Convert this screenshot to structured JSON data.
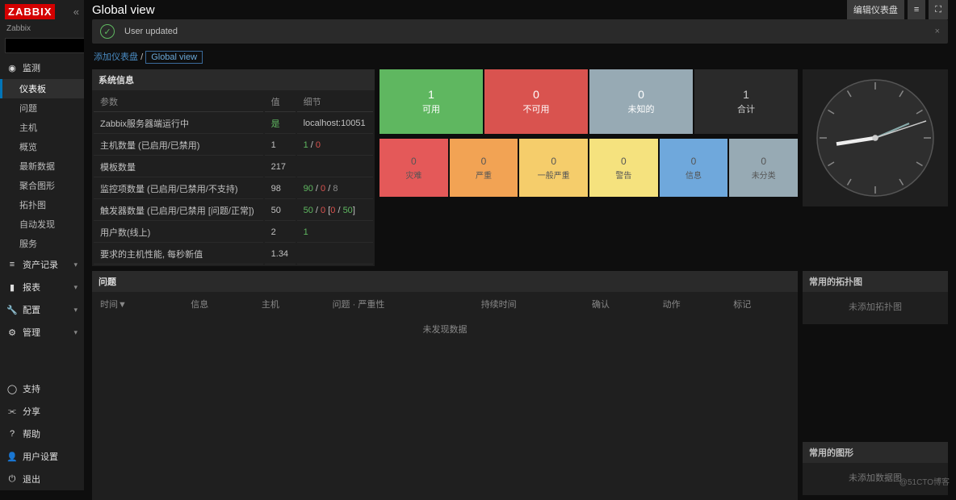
{
  "logo": "ZABBIX",
  "server_name": "Zabbix",
  "page_title": "Global view",
  "edit_dashboard_btn": "编辑仪表盘",
  "msg": "User updated",
  "breadcrumb": {
    "add": "添加仪表盘",
    "current": "Global view"
  },
  "nav": {
    "monitoring": "监测",
    "subs": [
      "仪表板",
      "问题",
      "主机",
      "概览",
      "最新数据",
      "聚合图形",
      "拓扑图",
      "自动发现",
      "服务"
    ],
    "inventory": "资产记录",
    "reports": "报表",
    "config": "配置",
    "admin": "管理",
    "support": "支持",
    "share": "分享",
    "help": "帮助",
    "usersettings": "用户设置",
    "logout": "退出"
  },
  "sysinfo": {
    "title": "系统信息",
    "h_param": "参数",
    "h_val": "值",
    "h_detail": "细节",
    "rows": [
      {
        "p": "Zabbix服务器端运行中",
        "v": "是",
        "vclass": "g",
        "d": "localhost:10051"
      },
      {
        "p": "主机数量 (已启用/已禁用)",
        "v": "1",
        "d": "<span class='g'>1</span> / <span class='r'>0</span>"
      },
      {
        "p": "模板数量",
        "v": "217",
        "d": ""
      },
      {
        "p": "监控项数量 (已启用/已禁用/不支持)",
        "v": "98",
        "d": "<span class='g'>90</span> / <span class='r'>0</span> / <span class='gr'>8</span>"
      },
      {
        "p": "触发器数量 (已启用/已禁用 [问题/正常])",
        "v": "50",
        "d": "<span class='g'>50</span> / <span class='r'>0</span> [<span class='r'>0</span> / <span class='g'>50</span>]"
      },
      {
        "p": "用户数(线上)",
        "v": "2",
        "d": "<span class='g'>1</span>"
      },
      {
        "p": "要求的主机性能, 每秒新值",
        "v": "1.34",
        "d": ""
      }
    ]
  },
  "host_status": [
    {
      "n": "1",
      "l": "可用",
      "c": "bg-green"
    },
    {
      "n": "0",
      "l": "不可用",
      "c": "bg-red"
    },
    {
      "n": "0",
      "l": "未知的",
      "c": "bg-grey"
    },
    {
      "n": "1",
      "l": "合计",
      "c": "bg-dark"
    }
  ],
  "severity": [
    {
      "n": "0",
      "l": "灾难",
      "c": "bg-red2"
    },
    {
      "n": "0",
      "l": "严重",
      "c": "bg-orange"
    },
    {
      "n": "0",
      "l": "一般严重",
      "c": "bg-yellow"
    },
    {
      "n": "0",
      "l": "警告",
      "c": "bg-yellow2"
    },
    {
      "n": "0",
      "l": "信息",
      "c": "bg-blue"
    },
    {
      "n": "0",
      "l": "未分类",
      "c": "bg-grey2"
    }
  ],
  "problems": {
    "title": "问题",
    "cols": [
      "时间▼",
      "信息",
      "主机",
      "问题 · 严重性",
      "持续时间",
      "确认",
      "动作",
      "标记"
    ],
    "empty": "未发现数据"
  },
  "fav_maps": {
    "title": "常用的拓扑图",
    "empty": "未添加拓扑图"
  },
  "fav_graphs": {
    "title": "常用的图形",
    "empty": "未添加数据图"
  },
  "watermark": "@51CTO博客"
}
